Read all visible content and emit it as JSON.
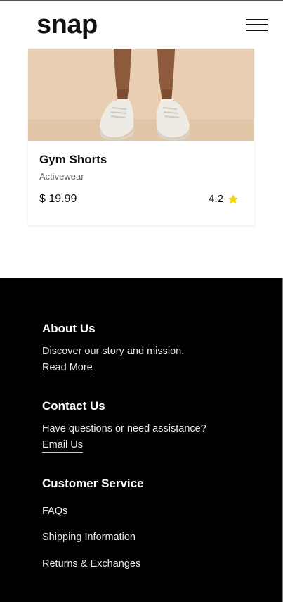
{
  "header": {
    "logo": "snap",
    "menu_icon": "hamburger-menu-icon"
  },
  "product": {
    "name": "Gym Shorts",
    "category": "Activewear",
    "price": "$ 19.99",
    "rating": "4.2",
    "rating_icon": "star-icon",
    "star_color": "#f5d300"
  },
  "footer": {
    "about": {
      "heading": "About Us",
      "text": "Discover our story and mission.",
      "link": "Read More"
    },
    "contact": {
      "heading": "Contact Us",
      "text": "Have questions or need assistance?",
      "link": "Email Us"
    },
    "service": {
      "heading": "Customer Service",
      "items": [
        "FAQs",
        "Shipping Information",
        "Returns & Exchanges"
      ]
    }
  }
}
